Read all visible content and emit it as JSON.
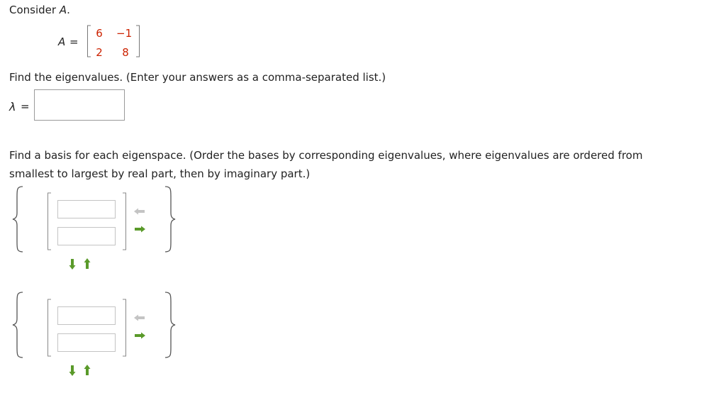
{
  "question": {
    "intro_prefix": "Consider ",
    "intro_var": "A",
    "intro_suffix": "."
  },
  "matrix": {
    "name": "A",
    "equals": "=",
    "cells": [
      [
        "6",
        "−1"
      ],
      [
        "2",
        "8"
      ]
    ]
  },
  "eigenvalues": {
    "instruction": "Find the eigenvalues. (Enter your answers as a comma-separated list.)",
    "lambda_symbol": "λ",
    "equals": "=",
    "value": ""
  },
  "eigenspace": {
    "instruction_line1": "Find a basis for each eigenspace. (Order the bases by corresponding eigenvalues, where eigenvalues are ordered from",
    "instruction_line2": "smallest to largest by real part, then by imaginary part.)",
    "bases": [
      {
        "vector": [
          "",
          ""
        ]
      },
      {
        "vector": [
          "",
          ""
        ]
      }
    ]
  },
  "icons": {
    "remove_column": "arrow-left-icon",
    "add_column": "arrow-right-icon",
    "remove_row": "arrow-down-icon",
    "add_row": "arrow-up-icon"
  },
  "colors": {
    "matrix_entries": "#cc2200",
    "arrow_active": "#5a9a2a",
    "arrow_inactive": "#c4c4c4"
  }
}
